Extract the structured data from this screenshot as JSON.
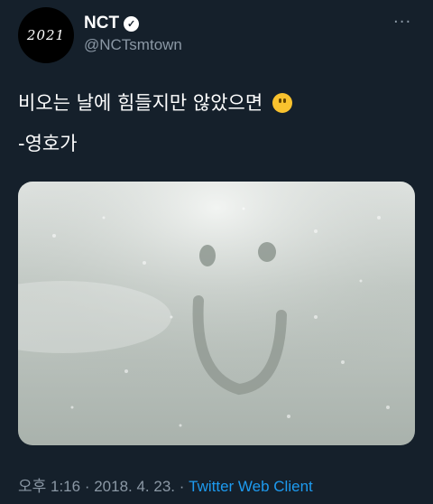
{
  "author": {
    "avatar_text": "2021",
    "name": "NCT",
    "verified_icon": "verified-badge-icon",
    "handle": "@NCTsmtown"
  },
  "menu": {
    "more_label": "···"
  },
  "tweet": {
    "line1": "비오는 날에 힘들지만 않았으면",
    "line2": "-영호가",
    "emoji_icon": "slightly-smiling-face-icon"
  },
  "media": {
    "description_icon": "fogged-window-smiley-photo"
  },
  "meta": {
    "time": "오후 1:16",
    "separator1": " · ",
    "date": "2018. 4. 23.",
    "separator2": " · ",
    "client": "Twitter Web Client"
  },
  "colors": {
    "background": "#15202b",
    "secondary_text": "#8b98a5",
    "link": "#1d9bf0"
  }
}
